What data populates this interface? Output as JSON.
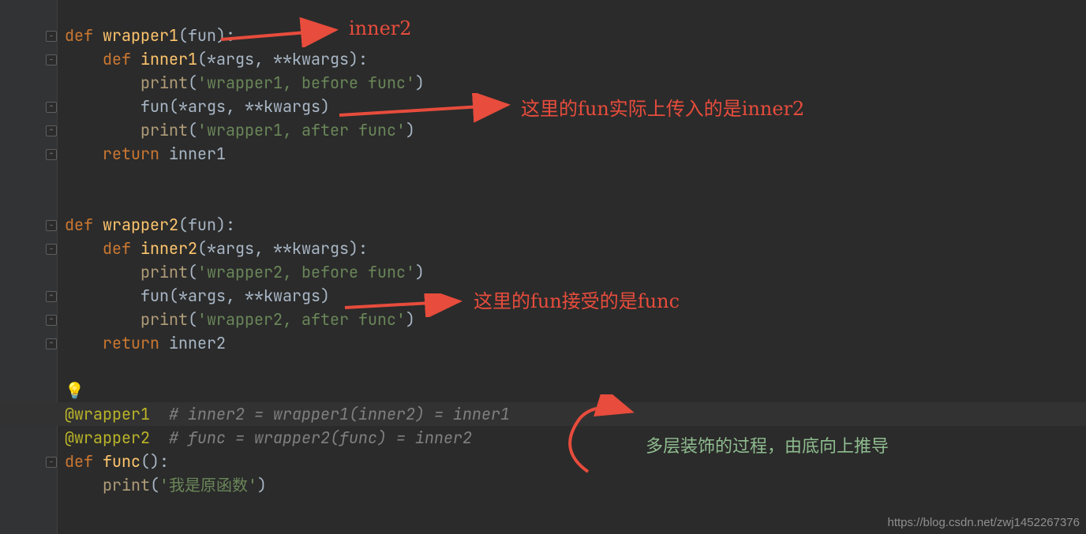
{
  "annotations": {
    "top_label": "inner2",
    "note1": "这里的fun实际上传入的是inner2",
    "note2": "这里的fun接受的是func",
    "note3": "多层装饰的过程，由底向上推导"
  },
  "bulb": "💡",
  "code": {
    "l1": "",
    "l2_def": "def ",
    "l2_fn": "wrapper1",
    "l2_rest": "(fun):",
    "l3_def": "    def ",
    "l3_fn": "inner1",
    "l3_rest": "(*args, **kwargs):",
    "l4_call": "        print",
    "l4_str": "'wrapper1, before func'",
    "l5_body": "        fun(*args, **kwargs)",
    "l6_call": "        print",
    "l6_str": "'wrapper1, after func'",
    "l7_ret": "    return ",
    "l7_id": "inner1",
    "l10_def": "def ",
    "l10_fn": "wrapper2",
    "l10_rest": "(fun):",
    "l11_def": "    def ",
    "l11_fn": "inner2",
    "l11_rest": "(*args, **kwargs):",
    "l12_call": "        print",
    "l12_str": "'wrapper2, before func'",
    "l13_body": "        fun(*args, **kwargs)",
    "l14_call": "        print",
    "l14_str": "'wrapper2, after func'",
    "l15_ret": "    return ",
    "l15_id": "inner2",
    "l18_dec": "@wrapper1",
    "l18_cmt": "  # inner2 = wrapper1(inner2) = inner1",
    "l19_dec": "@wrapper2",
    "l19_cmt": "  # func = wrapper2(func) = inner2",
    "l20_def": "def ",
    "l20_fn": "func",
    "l20_rest": "():",
    "l21_call": "    print",
    "l21_str": "'我是原函数'"
  },
  "watermark": "https://blog.csdn.net/zwj1452267376"
}
